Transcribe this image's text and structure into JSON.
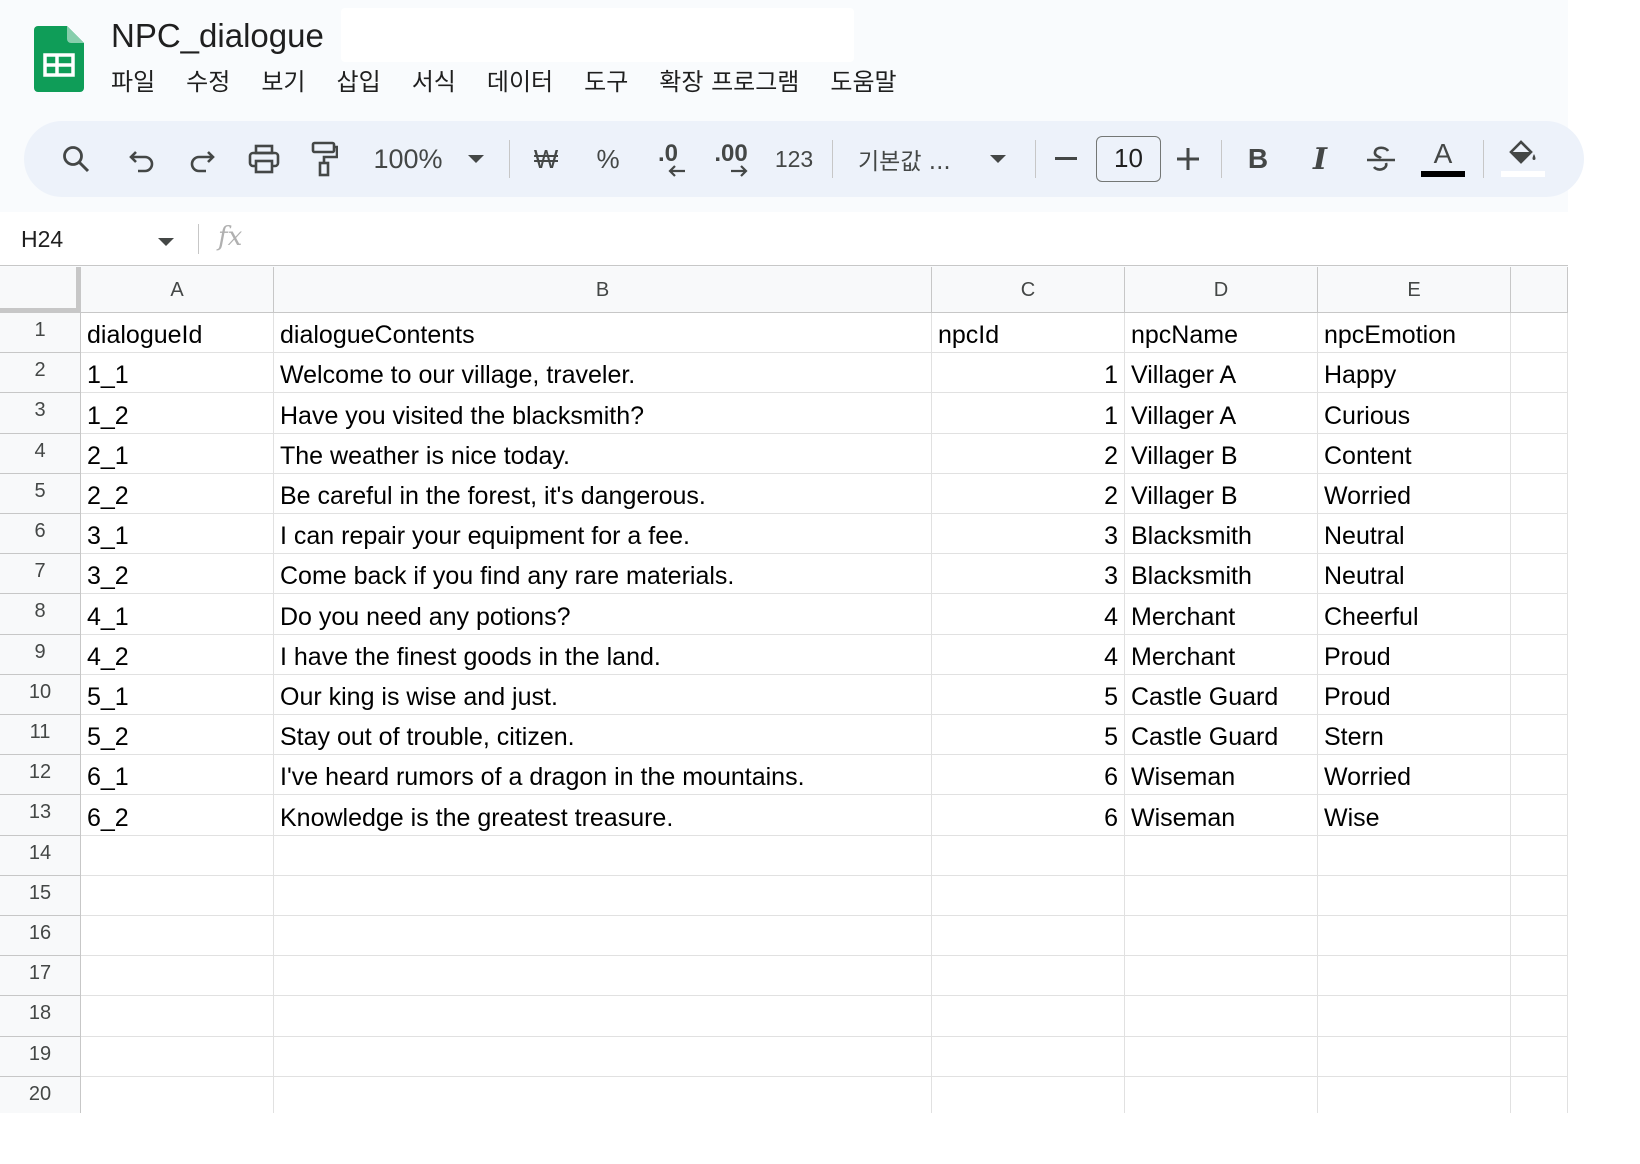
{
  "doc": {
    "title": "NPC_dialogue"
  },
  "menu": [
    "파일",
    "수정",
    "보기",
    "삽입",
    "서식",
    "데이터",
    "도구",
    "확장 프로그램",
    "도움말"
  ],
  "toolbar": {
    "zoom": "100%",
    "currency": "₩",
    "percent": "%",
    "decrease_decimal": ".0",
    "increase_decimal": ".00",
    "number_format": "123",
    "font": "기본값 ...",
    "font_size": "10",
    "bold": "B",
    "italic": "I",
    "text_color_letter": "A"
  },
  "formula_bar": {
    "cell_ref": "H24",
    "fx": "fx",
    "formula": ""
  },
  "sheet": {
    "columns": [
      "A",
      "B",
      "C",
      "D",
      "E"
    ],
    "row_numbers": [
      "1",
      "2",
      "3",
      "4",
      "5",
      "6",
      "7",
      "8",
      "9",
      "10",
      "11",
      "12",
      "13",
      "14",
      "15",
      "16",
      "17",
      "18",
      "19",
      "20"
    ],
    "rows": [
      [
        "dialogueId",
        "dialogueContents",
        "npcId",
        "npcName",
        "npcEmotion"
      ],
      [
        "1_1",
        "Welcome to our village, traveler.",
        "1",
        "Villager A",
        "Happy"
      ],
      [
        "1_2",
        "Have you visited the blacksmith?",
        "1",
        "Villager A",
        "Curious"
      ],
      [
        "2_1",
        "The weather is nice today.",
        "2",
        "Villager B",
        "Content"
      ],
      [
        "2_2",
        "Be careful in the forest, it's dangerous.",
        "2",
        "Villager B",
        "Worried"
      ],
      [
        "3_1",
        "I can repair your equipment for a fee.",
        "3",
        "Blacksmith",
        "Neutral"
      ],
      [
        "3_2",
        "Come back if you find any rare materials.",
        "3",
        "Blacksmith",
        "Neutral"
      ],
      [
        "4_1",
        "Do you need any potions?",
        "4",
        "Merchant",
        "Cheerful"
      ],
      [
        "4_2",
        "I have the finest goods in the land.",
        "4",
        "Merchant",
        "Proud"
      ],
      [
        "5_1",
        "Our king is wise and just.",
        "5",
        "Castle Guard",
        "Proud"
      ],
      [
        "5_2",
        "Stay out of trouble, citizen.",
        "5",
        "Castle Guard",
        "Stern"
      ],
      [
        "6_1",
        "I've heard rumors of a dragon in the mountains.",
        "6",
        "Wiseman",
        "Worried"
      ],
      [
        "6_2",
        "Knowledge is the greatest treasure.",
        "6",
        "Wiseman",
        "Wise"
      ]
    ]
  },
  "colors": {
    "accent": "#0f9d58",
    "toolbar_bg": "#edf2fa",
    "grid_line": "#e1e1e1",
    "header_bg": "#f8f9fa"
  }
}
